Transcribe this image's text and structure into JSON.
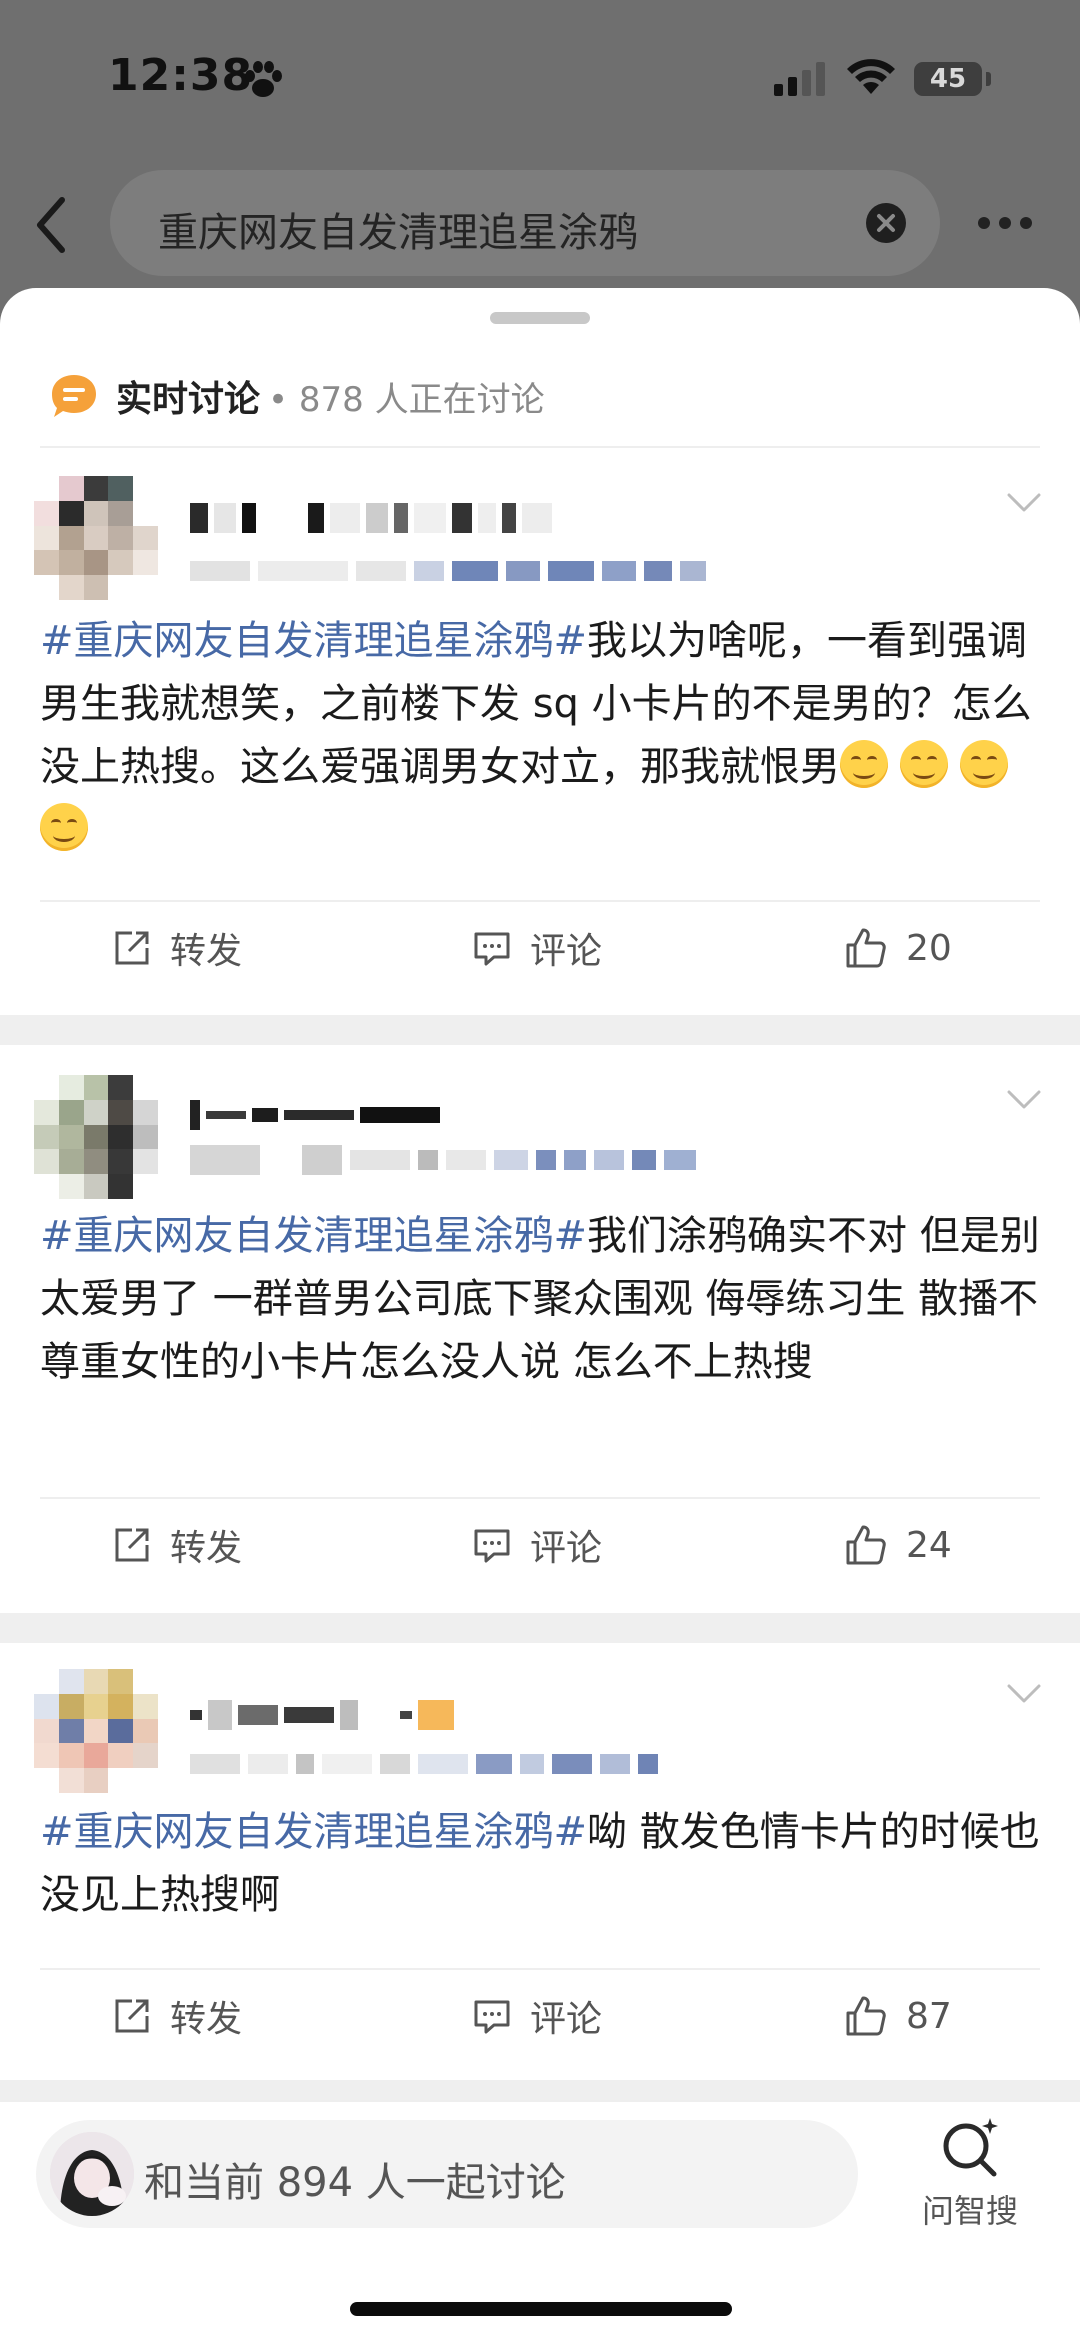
{
  "status_bar": {
    "time": "12:38",
    "battery": "45"
  },
  "header": {
    "search_query": "重庆网友自发清理追星涂鸦"
  },
  "live": {
    "title": "实时讨论",
    "count_text": "• 878 人正在讨论"
  },
  "posts": [
    {
      "topic": "#重庆网友自发清理追星涂鸦#",
      "text": "我以为啥呢，一看到强调男生我就想笑，之前楼下发 sq 小卡片的不是男的？怎么没上热搜。这么爱强调男女对立，那我就恨男",
      "emoji_count": 4,
      "repost": "转发",
      "comment": "评论",
      "likes": "20"
    },
    {
      "topic": "#重庆网友自发清理追星涂鸦#",
      "text": "我们涂鸦确实不对 但是别太爱男了 一群普男公司底下聚众围观 侮辱练习生 散播不尊重女性的小卡片怎么没人说 怎么不上热搜",
      "repost": "转发",
      "comment": "评论",
      "likes": "24"
    },
    {
      "topic": "#重庆网友自发清理追星涂鸦#",
      "text": "呦 散发色情卡片的时候也没见上热搜啊",
      "repost": "转发",
      "comment": "评论",
      "likes": "87"
    }
  ],
  "bottom": {
    "placeholder": "和当前 894 人一起讨论",
    "zhisou": "问智搜"
  },
  "colors": {
    "topic_blue": "#4769a6",
    "live_icon_orange": "#f5a13a"
  }
}
